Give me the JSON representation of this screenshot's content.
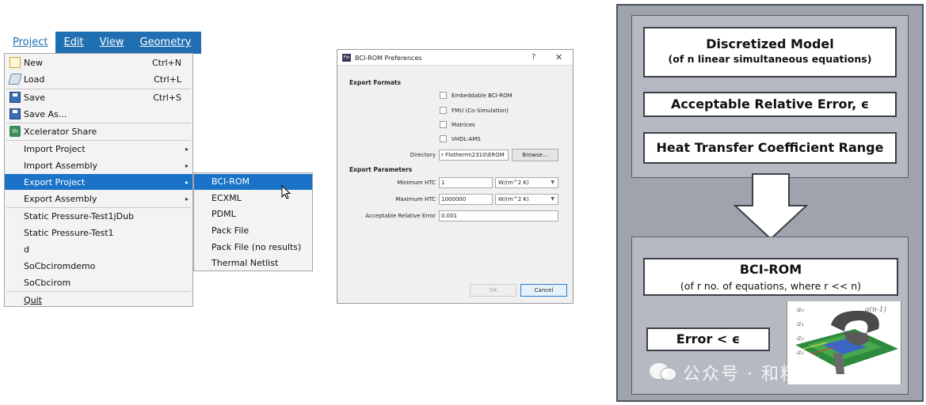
{
  "menubar": {
    "items": [
      {
        "label": "Project",
        "active": true
      },
      {
        "label": "Edit",
        "active": false
      },
      {
        "label": "View",
        "active": false
      },
      {
        "label": "Geometry",
        "active": false
      }
    ]
  },
  "project_menu": {
    "new": {
      "label": "New",
      "shortcut": "Ctrl+N",
      "icon": "new-document-icon"
    },
    "load": {
      "label": "Load",
      "shortcut": "Ctrl+L",
      "icon": "load-icon"
    },
    "save": {
      "label": "Save",
      "shortcut": "Ctrl+S",
      "icon": "save-icon"
    },
    "save_as": {
      "label": "Save As...",
      "icon": "save-as-icon"
    },
    "share": {
      "label": "Xcelerator Share",
      "icon": "xcelerator-share-icon",
      "icon_text": "th"
    },
    "import_project": "Import Project",
    "import_assembly": "Import Assembly",
    "export_project": "Export Project",
    "export_assembly": "Export Assembly",
    "recent": [
      "Static Pressure-Test1jDub",
      "Static Pressure-Test1",
      "d",
      "SoCbciromdemo",
      "SoCbcirom"
    ],
    "quit": "Quit",
    "submenu_arrow": "▸"
  },
  "export_submenu": {
    "items": [
      "BCI-ROM",
      "ECXML",
      "PDML",
      "Pack File",
      "Pack File (no results)",
      "Thermal Netlist"
    ],
    "highlighted": "BCI-ROM"
  },
  "dialog": {
    "title": "BCI-ROM Preferences",
    "app_icon_text": "Flo",
    "help": "?",
    "close": "✕",
    "export_formats_title": "Export Formats",
    "formats": [
      {
        "label": "Embeddable BCI-ROM",
        "checked": false
      },
      {
        "label": "FMU (Co-Simulation)",
        "checked": false
      },
      {
        "label": "Matrices",
        "checked": false
      },
      {
        "label": "VHDL-AMS",
        "checked": false
      }
    ],
    "directory_label": "Directory",
    "directory_value": "r Flotherm\\2310\\EROM",
    "browse_label": "Browse...",
    "export_params_title": "Export Parameters",
    "min_htc_label": "Minimum HTC",
    "min_htc_value": "1",
    "min_htc_unit": "W/(m^2 K)",
    "max_htc_label": "Maximum HTC",
    "max_htc_value": "1000000",
    "max_htc_unit": "W/(m^2 K)",
    "rel_error_label": "Acceptable Relative Error",
    "rel_error_value": "0.001",
    "ok_label": "OK",
    "cancel_label": "Cancel"
  },
  "diagram": {
    "box1_title": "Discretized Model",
    "box1_sub": "(of n linear simultaneous equations)",
    "box2": "Acceptable Relative Error, ϵ",
    "box3": "Heat Transfer Coefficient Range",
    "rom_title": "BCI-ROM",
    "rom_sub": "(of r no. of equations, where r << n)",
    "error_box": "Error < ϵ",
    "matrix_labels": [
      "a₀",
      "a₁",
      "a₂",
      "a₃",
      "a(n-1)"
    ],
    "watermark": "公众号 · 和粒科技"
  }
}
